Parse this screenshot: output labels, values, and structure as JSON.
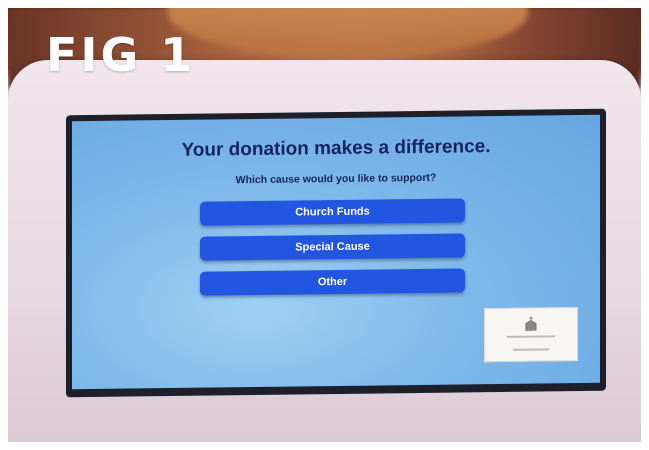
{
  "figure_label": "FIG 1",
  "kiosk": {
    "headline": "Your donation makes a difference.",
    "prompt": "Which cause would you like to support?",
    "options": [
      {
        "label": "Church Funds"
      },
      {
        "label": "Special Cause"
      },
      {
        "label": "Other"
      }
    ]
  },
  "colors": {
    "screen_background": "#7db8ea",
    "button": "#2356e0",
    "headline_text": "#15245f"
  },
  "icons": [
    "church-logo-icon"
  ]
}
